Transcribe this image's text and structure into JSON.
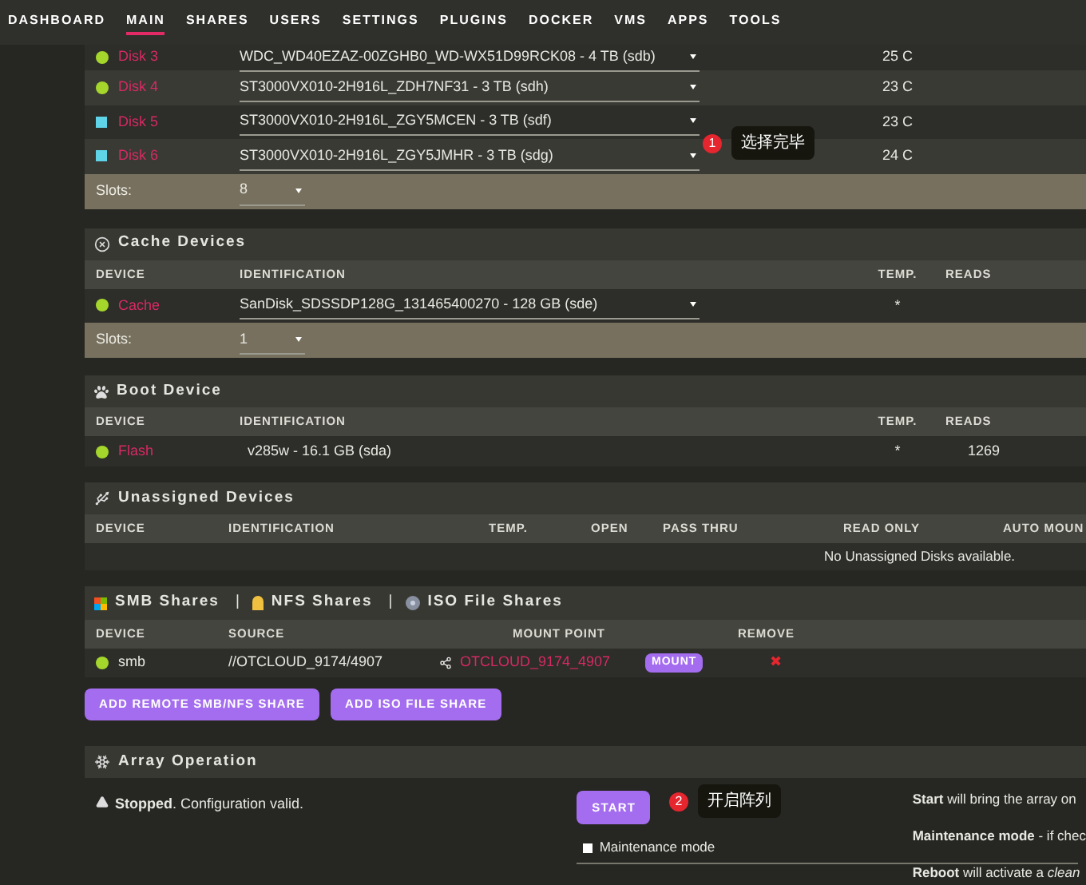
{
  "nav": [
    {
      "label": "DASHBOARD",
      "selected": false
    },
    {
      "label": "MAIN",
      "selected": true
    },
    {
      "label": "SHARES",
      "selected": false
    },
    {
      "label": "USERS",
      "selected": false
    },
    {
      "label": "SETTINGS",
      "selected": false
    },
    {
      "label": "PLUGINS",
      "selected": false
    },
    {
      "label": "DOCKER",
      "selected": false
    },
    {
      "label": "VMS",
      "selected": false
    },
    {
      "label": "APPS",
      "selected": false
    },
    {
      "label": "TOOLS",
      "selected": false
    }
  ],
  "array_devices": {
    "rows": [
      {
        "device": "Disk 3",
        "status": {
          "kind": "dot",
          "color": "#a4d62b"
        },
        "identification": "WDC_WD40EZAZ-00ZGHB0_WD-WX51D99RCK08 - 4 TB (sdb)",
        "temp": "25 C"
      },
      {
        "device": "Disk 4",
        "status": {
          "kind": "dot",
          "color": "#a4d62b"
        },
        "identification": "ST3000VX010-2H916L_ZDH7NF31 - 3 TB (sdh)",
        "temp": "23 C"
      },
      {
        "device": "Disk 5",
        "status": {
          "kind": "square",
          "color": "#5fd3e8"
        },
        "identification": "ST3000VX010-2H916L_ZGY5MCEN - 3 TB (sdf)",
        "temp": "23 C"
      },
      {
        "device": "Disk 6",
        "status": {
          "kind": "square",
          "color": "#5fd3e8"
        },
        "identification": "ST3000VX010-2H916L_ZGY5JMHR - 3 TB (sdg)",
        "temp": "24 C"
      }
    ],
    "slots_label": "Slots:",
    "slots_value": "8",
    "note": {
      "number": "1",
      "text": "选择完毕"
    }
  },
  "cache_devices": {
    "title": "Cache Devices",
    "columns": [
      "DEVICE",
      "IDENTIFICATION",
      "TEMP.",
      "READS"
    ],
    "rows": [
      {
        "device": "Cache",
        "status": {
          "kind": "dot",
          "color": "#a4d62b"
        },
        "identification": "SanDisk_SDSSDP128G_131465400270 - 128 GB (sde)",
        "temp": "*"
      }
    ],
    "slots_label": "Slots:",
    "slots_value": "1"
  },
  "boot_device": {
    "title": "Boot Device",
    "columns": [
      "DEVICE",
      "IDENTIFICATION",
      "TEMP.",
      "READS"
    ],
    "rows": [
      {
        "device": "Flash",
        "status": {
          "kind": "dot",
          "color": "#a4d62b"
        },
        "identification": "v285w - 16.1 GB (sda)",
        "temp": "*",
        "reads": "1269"
      }
    ]
  },
  "unassigned_devices": {
    "title": "Unassigned Devices",
    "columns": [
      "DEVICE",
      "IDENTIFICATION",
      "TEMP.",
      "OPEN",
      "PASS THRU",
      "READ ONLY",
      "AUTO MOUN"
    ],
    "empty_message": "No Unassigned Disks available."
  },
  "remote_shares": {
    "tabs": [
      "SMB Shares",
      "NFS Shares",
      "ISO File Shares"
    ],
    "separator": "|",
    "columns": [
      "DEVICE",
      "SOURCE",
      "MOUNT POINT",
      "REMOVE"
    ],
    "rows": [
      {
        "device": "smb",
        "status": {
          "kind": "dot",
          "color": "#a4d62b"
        },
        "source": "//OTCLOUD_9174/4907",
        "mount_point": "OTCLOUD_9174_4907",
        "action": "MOUNT",
        "remove": "✖"
      }
    ],
    "buttons": [
      "ADD REMOTE SMB/NFS SHARE",
      "ADD ISO FILE SHARE"
    ]
  },
  "array_operation": {
    "title": "Array Operation",
    "status": "**Stopped**. Configuration valid.",
    "start_button": "START",
    "note": {
      "number": "2",
      "text": "开启阵列"
    },
    "maintenance": {
      "label": "Maintenance mode",
      "checked": false
    },
    "help": [
      "**Start** will bring the array on",
      "**Maintenance mode** - if chec",
      "**Reboot** will activate a *clean*"
    ]
  }
}
